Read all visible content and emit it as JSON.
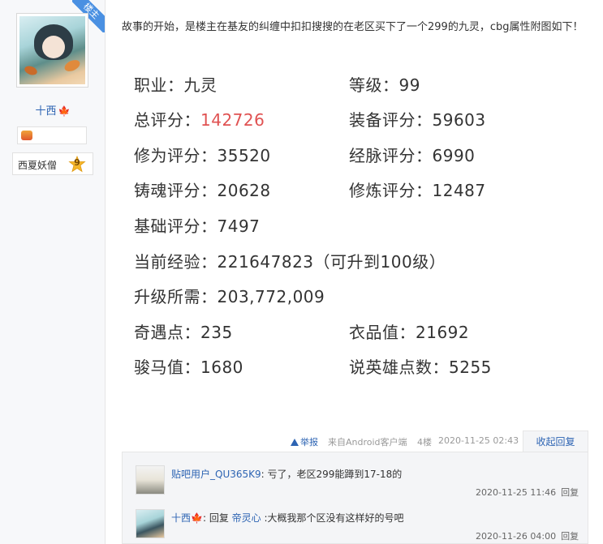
{
  "user": {
    "role_badge": "楼主",
    "name": "十西",
    "name_icon": "maple-leaf-icon",
    "title": "西夏妖僧",
    "level": "9"
  },
  "post": {
    "intro": "故事的开始，是楼主在基友的纠缠中扣扣搜搜的在老区买下了一个299的九灵，cbg属性附图如下！",
    "stats": {
      "job_label": "职业：",
      "job_value": "九灵",
      "level_label": "等级：",
      "level_value": "99",
      "total_label": "总评分：",
      "total_value": "142726",
      "equip_label": "装备评分：",
      "equip_value": "59603",
      "cult_label": "修为评分：",
      "cult_value": "35520",
      "meridian_label": "经脉评分：",
      "meridian_value": "6990",
      "soul_label": "铸魂评分：",
      "soul_value": "20628",
      "refine_label": "修炼评分：",
      "refine_value": "12487",
      "base_label": "基础评分：",
      "base_value": "7497",
      "exp_label": "当前经验：",
      "exp_value": "221647823（可升到100级）",
      "need_label": "升级所需：",
      "need_value": "203,772,009",
      "qiyu_label": "奇遇点：",
      "qiyu_value": "235",
      "yipin_label": "衣品值：",
      "yipin_value": "21692",
      "horse_label": "骏马值：",
      "horse_value": "1680",
      "hero_label": "说英雄点数：",
      "hero_value": "5255"
    }
  },
  "tail": {
    "report": "举报",
    "source": "来自Android客户端",
    "floor": "4楼",
    "time": "2020-11-25 02:43",
    "collapse": "收起回复"
  },
  "replies": [
    {
      "user": "贴吧用户_QU365K9",
      "text": ": 亏了，老区299能蹲到17-18的",
      "time": "2020-11-25 11:46",
      "reply": "回复"
    },
    {
      "user": "十西",
      "reply_word": ": 回复",
      "target": "帝灵心",
      "text": " :大概我那个区没有这样好的号吧",
      "time": "2020-11-26 04:00",
      "reply": "回复"
    }
  ]
}
